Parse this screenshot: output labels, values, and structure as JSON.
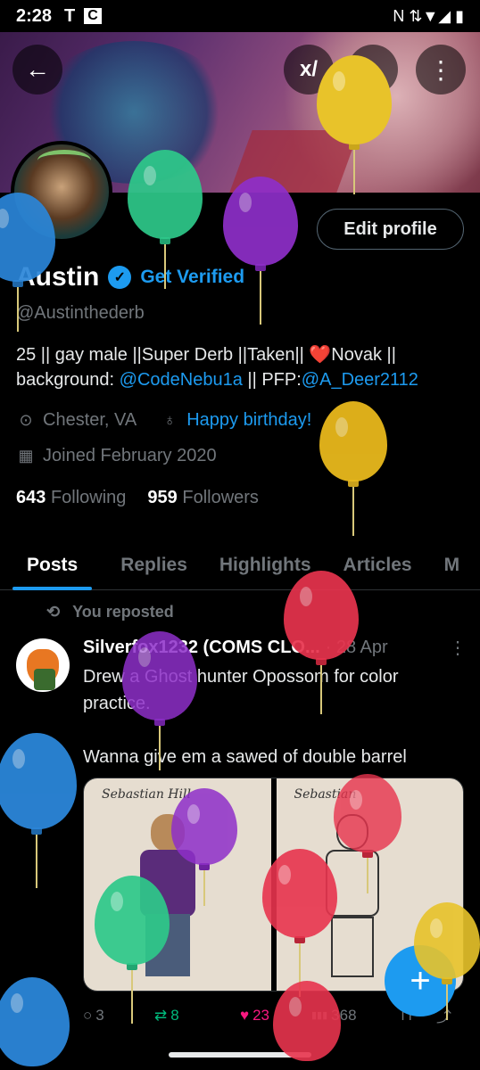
{
  "status_bar": {
    "time": "2:28",
    "carrier_icon": "T",
    "app_icon": "C",
    "right_icons": "N ⇅▼◢ ▮"
  },
  "header": {
    "back_icon": "←",
    "grok_icon": "x/",
    "search_icon": "⌕",
    "more_icon": "⋮"
  },
  "profile": {
    "edit_button": "Edit profile",
    "name": "Austin",
    "verified_mark": "✓",
    "get_verified": "Get Verified",
    "handle": "@Austinthederb",
    "bio_part1": "25 || gay male ||Super Derb ||Taken|| ",
    "bio_heart": "❤️",
    "bio_part2": "Novak || background: ",
    "bio_link1": "@CodeNebu1a",
    "bio_part3": " || PFP:",
    "bio_link2": "@A_Deer2112",
    "location": "Chester, VA",
    "birthday": "Happy birthday!",
    "joined": "Joined February 2020",
    "following_count": "643",
    "following_label": "Following",
    "followers_count": "959",
    "followers_label": "Followers"
  },
  "tabs": [
    "Posts",
    "Replies",
    "Highlights",
    "Articles",
    "M"
  ],
  "post": {
    "repost_label": "You reposted",
    "repost_icon": "⟲",
    "author": "Silverfox1232 (COMS CLO...",
    "time": "· 28 Apr",
    "more": "⋮",
    "text_line1": "Drew a Ghost hunter Opossom for color practice.",
    "text_line2": "Wanna give em a sawed of double barrel",
    "img1_title": "Sebastian Hill",
    "img2_title": "Sebastian",
    "reply_count": "3",
    "retweet_count": "8",
    "like_count": "23",
    "view_count": "368",
    "icons": {
      "reply": "○",
      "retweet": "⇄",
      "like": "♥",
      "views": "▮▮▮",
      "bookmark": "⊓",
      "share": "⤴"
    }
  },
  "fab_label": "+",
  "colors": {
    "accent": "#1d9bf0",
    "like": "#f91880",
    "retweet": "#00ba7c",
    "background": "#000000"
  }
}
